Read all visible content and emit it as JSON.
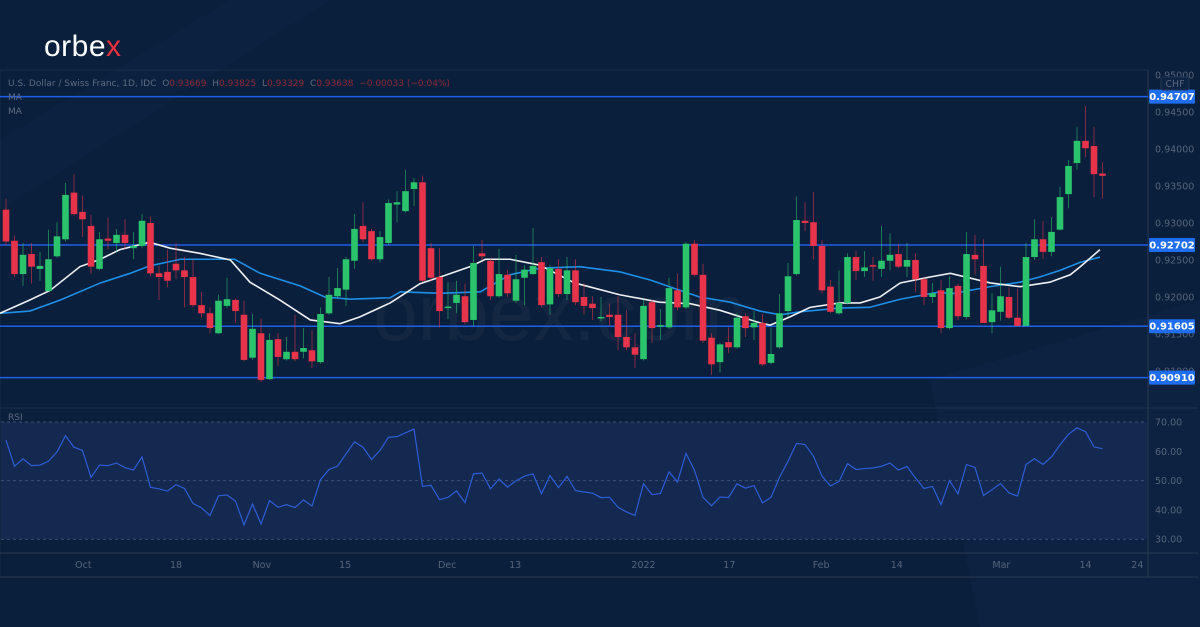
{
  "brand": {
    "logo_main": "orbe",
    "logo_x": "x",
    "watermark": "orbex.com"
  },
  "legend": {
    "symbol": "U.S. Dollar / Swiss Franc, 1D, IDC",
    "o_label": "O",
    "o": "0.93669",
    "h_label": "H",
    "h": "0.93825",
    "l_label": "L",
    "l": "0.93329",
    "c_label": "C",
    "c": "0.93638",
    "change": "−0.00033 (−0.04%)",
    "ma1": "MA",
    "ma2": "MA",
    "rsi": "RSI"
  },
  "colors": {
    "up": "#2bc46d",
    "down": "#e8344a",
    "level": "#1f5fe8",
    "level_box": "#1f6ef2",
    "ma_fast": "#eef0f2",
    "ma_slow": "#1e8fe8",
    "rsi": "#2d5ed8",
    "rsi_band": "#15284f"
  },
  "chart_data": {
    "type": "candlestick",
    "title": "U.S. Dollar / Swiss Franc, 1D, IDC",
    "currency_label": "CHF",
    "ylim": [
      0.9075,
      0.9505
    ],
    "yticks": [
      "0.95000",
      "0.94500",
      "0.94000",
      "0.93500",
      "0.93000",
      "0.92500",
      "0.92000",
      "0.91500",
      "0.91000"
    ],
    "levels": [
      "0.94707",
      "0.92702",
      "0.91605",
      "0.90910"
    ],
    "xticks": [
      {
        "label": "Oct",
        "i": 9.1
      },
      {
        "label": "18",
        "i": 20
      },
      {
        "label": "Nov",
        "i": 30.1
      },
      {
        "label": "15",
        "i": 39.9
      },
      {
        "label": "Dec",
        "i": 51.9
      },
      {
        "label": "13",
        "i": 59.9
      },
      {
        "label": "2022",
        "i": 75
      },
      {
        "label": "17",
        "i": 85.1
      },
      {
        "label": "Feb",
        "i": 95.9
      },
      {
        "label": "14",
        "i": 104.8
      },
      {
        "label": "Mar",
        "i": 117.1
      },
      {
        "label": "14",
        "i": 127
      },
      {
        "label": "24",
        "i": 133.1
      }
    ],
    "ohlc_fields": [
      "open",
      "high",
      "low",
      "close"
    ],
    "candles": [
      [
        0.9318,
        0.9333,
        0.927,
        0.9275
      ],
      [
        0.9276,
        0.9283,
        0.9227,
        0.9231
      ],
      [
        0.9231,
        0.9273,
        0.9215,
        0.9257
      ],
      [
        0.9258,
        0.9273,
        0.9218,
        0.9241
      ],
      [
        0.9238,
        0.9261,
        0.9222,
        0.9242
      ],
      [
        0.9208,
        0.9291,
        0.9208,
        0.9251
      ],
      [
        0.9255,
        0.9301,
        0.9253,
        0.9282
      ],
      [
        0.9278,
        0.9354,
        0.9275,
        0.9338
      ],
      [
        0.9341,
        0.9366,
        0.931,
        0.9312
      ],
      [
        0.9315,
        0.9337,
        0.9281,
        0.9305
      ],
      [
        0.9296,
        0.9311,
        0.9231,
        0.9241
      ],
      [
        0.9238,
        0.9288,
        0.9236,
        0.9278
      ],
      [
        0.9279,
        0.9307,
        0.9264,
        0.9276
      ],
      [
        0.9273,
        0.9292,
        0.9261,
        0.9284
      ],
      [
        0.9284,
        0.9305,
        0.9265,
        0.9273
      ],
      [
        0.9266,
        0.9288,
        0.9251,
        0.9269
      ],
      [
        0.9269,
        0.9312,
        0.9266,
        0.9303
      ],
      [
        0.93,
        0.9309,
        0.9228,
        0.9232
      ],
      [
        0.9232,
        0.9242,
        0.9196,
        0.9227
      ],
      [
        0.9234,
        0.9264,
        0.9213,
        0.9222
      ],
      [
        0.9245,
        0.9273,
        0.9224,
        0.9236
      ],
      [
        0.9236,
        0.9254,
        0.9186,
        0.9227
      ],
      [
        0.9227,
        0.9251,
        0.9186,
        0.9189
      ],
      [
        0.9189,
        0.9207,
        0.9172,
        0.9178
      ],
      [
        0.9178,
        0.9186,
        0.9151,
        0.9158
      ],
      [
        0.9151,
        0.9203,
        0.915,
        0.9195
      ],
      [
        0.9188,
        0.9226,
        0.9185,
        0.9197
      ],
      [
        0.9196,
        0.9198,
        0.9165,
        0.9181
      ],
      [
        0.9176,
        0.9195,
        0.9113,
        0.9115
      ],
      [
        0.9118,
        0.9177,
        0.9115,
        0.9157
      ],
      [
        0.9151,
        0.9171,
        0.9085,
        0.9088
      ],
      [
        0.9089,
        0.9151,
        0.9088,
        0.9142
      ],
      [
        0.9143,
        0.9151,
        0.9107,
        0.9119
      ],
      [
        0.9116,
        0.9146,
        0.9114,
        0.9126
      ],
      [
        0.9126,
        0.9176,
        0.9113,
        0.9116
      ],
      [
        0.9126,
        0.9158,
        0.9117,
        0.9131
      ],
      [
        0.9128,
        0.9155,
        0.9104,
        0.9113
      ],
      [
        0.9112,
        0.9186,
        0.911,
        0.9177
      ],
      [
        0.9178,
        0.9227,
        0.9176,
        0.9203
      ],
      [
        0.9201,
        0.9239,
        0.9199,
        0.9212
      ],
      [
        0.921,
        0.9254,
        0.9188,
        0.9251
      ],
      [
        0.9249,
        0.9312,
        0.9238,
        0.9292
      ],
      [
        0.9296,
        0.9328,
        0.9274,
        0.9278
      ],
      [
        0.9289,
        0.9292,
        0.9249,
        0.9251
      ],
      [
        0.9251,
        0.9289,
        0.9247,
        0.9281
      ],
      [
        0.9273,
        0.9332,
        0.927,
        0.9327
      ],
      [
        0.9325,
        0.9343,
        0.9301,
        0.9328
      ],
      [
        0.9316,
        0.9372,
        0.9314,
        0.9343
      ],
      [
        0.9346,
        0.9361,
        0.9323,
        0.9355
      ],
      [
        0.9355,
        0.9364,
        0.922,
        0.9222
      ],
      [
        0.9266,
        0.9273,
        0.9222,
        0.9226
      ],
      [
        0.9227,
        0.9266,
        0.9159,
        0.9181
      ],
      [
        0.9185,
        0.922,
        0.917,
        0.9187
      ],
      [
        0.9192,
        0.9222,
        0.9178,
        0.9203
      ],
      [
        0.9201,
        0.9218,
        0.9163,
        0.9166
      ],
      [
        0.9169,
        0.9269,
        0.9161,
        0.9246
      ],
      [
        0.9259,
        0.9277,
        0.925,
        0.9255
      ],
      [
        0.9249,
        0.9251,
        0.9196,
        0.9201
      ],
      [
        0.9201,
        0.9265,
        0.9199,
        0.9231
      ],
      [
        0.923,
        0.9236,
        0.92,
        0.9205
      ],
      [
        0.9195,
        0.9257,
        0.9192,
        0.9224
      ],
      [
        0.9226,
        0.9243,
        0.9189,
        0.9237
      ],
      [
        0.9231,
        0.9293,
        0.923,
        0.9242
      ],
      [
        0.9247,
        0.9254,
        0.9186,
        0.9189
      ],
      [
        0.919,
        0.9243,
        0.9176,
        0.9239
      ],
      [
        0.9238,
        0.9251,
        0.92,
        0.9204
      ],
      [
        0.9204,
        0.9254,
        0.9196,
        0.9236
      ],
      [
        0.9236,
        0.9251,
        0.9189,
        0.9193
      ],
      [
        0.92,
        0.9219,
        0.9176,
        0.9188
      ],
      [
        0.9191,
        0.9201,
        0.9169,
        0.9185
      ],
      [
        0.9171,
        0.92,
        0.9167,
        0.9173
      ],
      [
        0.9176,
        0.9191,
        0.9161,
        0.9173
      ],
      [
        0.9176,
        0.9201,
        0.9128,
        0.9146
      ],
      [
        0.9146,
        0.9182,
        0.9128,
        0.9132
      ],
      [
        0.9132,
        0.9151,
        0.9104,
        0.9122
      ],
      [
        0.9116,
        0.9196,
        0.9114,
        0.9188
      ],
      [
        0.9193,
        0.9196,
        0.9138,
        0.9158
      ],
      [
        0.9161,
        0.9184,
        0.9142,
        0.9162
      ],
      [
        0.9159,
        0.9226,
        0.9157,
        0.9212
      ],
      [
        0.9209,
        0.9232,
        0.9182,
        0.9186
      ],
      [
        0.9186,
        0.9274,
        0.9184,
        0.9272
      ],
      [
        0.9272,
        0.9277,
        0.9228,
        0.923
      ],
      [
        0.923,
        0.9245,
        0.9138,
        0.9141
      ],
      [
        0.9145,
        0.9151,
        0.9095,
        0.9109
      ],
      [
        0.9112,
        0.9138,
        0.9098,
        0.9136
      ],
      [
        0.9139,
        0.9159,
        0.9124,
        0.9132
      ],
      [
        0.9132,
        0.9178,
        0.913,
        0.9172
      ],
      [
        0.9174,
        0.9178,
        0.9146,
        0.9158
      ],
      [
        0.9159,
        0.9181,
        0.9142,
        0.9165
      ],
      [
        0.9165,
        0.9177,
        0.9107,
        0.9109
      ],
      [
        0.9111,
        0.9159,
        0.9109,
        0.9123
      ],
      [
        0.9132,
        0.9204,
        0.913,
        0.9178
      ],
      [
        0.9181,
        0.9246,
        0.9173,
        0.9228
      ],
      [
        0.9231,
        0.9336,
        0.9229,
        0.9304
      ],
      [
        0.9303,
        0.9328,
        0.9289,
        0.93
      ],
      [
        0.9301,
        0.9342,
        0.9251,
        0.9269
      ],
      [
        0.9269,
        0.9277,
        0.9205,
        0.9209
      ],
      [
        0.9214,
        0.9223,
        0.9178,
        0.918
      ],
      [
        0.9178,
        0.9236,
        0.9176,
        0.9192
      ],
      [
        0.9192,
        0.9259,
        0.919,
        0.9254
      ],
      [
        0.9254,
        0.9262,
        0.9223,
        0.9235
      ],
      [
        0.9235,
        0.9262,
        0.9227,
        0.924
      ],
      [
        0.9243,
        0.9254,
        0.9222,
        0.9241
      ],
      [
        0.9238,
        0.9296,
        0.9227,
        0.9249
      ],
      [
        0.9249,
        0.9286,
        0.9236,
        0.9257
      ],
      [
        0.9258,
        0.9272,
        0.9239,
        0.9241
      ],
      [
        0.9241,
        0.9273,
        0.9227,
        0.925
      ],
      [
        0.925,
        0.9259,
        0.9207,
        0.9224
      ],
      [
        0.9224,
        0.9226,
        0.9189,
        0.92
      ],
      [
        0.92,
        0.9219,
        0.9192,
        0.9205
      ],
      [
        0.9209,
        0.9223,
        0.9151,
        0.9158
      ],
      [
        0.9158,
        0.9228,
        0.9156,
        0.9212
      ],
      [
        0.9215,
        0.9218,
        0.9169,
        0.9174
      ],
      [
        0.9173,
        0.9288,
        0.917,
        0.9258
      ],
      [
        0.9257,
        0.9284,
        0.923,
        0.9251
      ],
      [
        0.9242,
        0.9278,
        0.9165,
        0.9165
      ],
      [
        0.9166,
        0.9205,
        0.9151,
        0.9182
      ],
      [
        0.918,
        0.9241,
        0.9168,
        0.9201
      ],
      [
        0.92,
        0.9213,
        0.917,
        0.9172
      ],
      [
        0.9172,
        0.9211,
        0.916,
        0.9161
      ],
      [
        0.9161,
        0.9273,
        0.916,
        0.9254
      ],
      [
        0.9254,
        0.9305,
        0.925,
        0.9278
      ],
      [
        0.9278,
        0.9303,
        0.9251,
        0.9261
      ],
      [
        0.9261,
        0.9308,
        0.9255,
        0.9288
      ],
      [
        0.9291,
        0.9349,
        0.929,
        0.9335
      ],
      [
        0.9339,
        0.9385,
        0.932,
        0.9377
      ],
      [
        0.9381,
        0.943,
        0.9372,
        0.9411
      ],
      [
        0.9411,
        0.9458,
        0.9389,
        0.9401
      ],
      [
        0.9404,
        0.943,
        0.9335,
        0.9366
      ],
      [
        0.93669,
        0.93825,
        0.93329,
        0.93638
      ]
    ],
    "ma_fast": [
      [
        -0.7,
        0.9178
      ],
      [
        2.8,
        0.9196
      ],
      [
        5.2,
        0.9209
      ],
      [
        8.7,
        0.9241
      ],
      [
        11.1,
        0.9251
      ],
      [
        13.4,
        0.9264
      ],
      [
        16.9,
        0.9274
      ],
      [
        19.3,
        0.9266
      ],
      [
        22.8,
        0.9259
      ],
      [
        26.4,
        0.925
      ],
      [
        28.7,
        0.922
      ],
      [
        32.2,
        0.9196
      ],
      [
        35.8,
        0.9169
      ],
      [
        39.3,
        0.9164
      ],
      [
        41.6,
        0.9173
      ],
      [
        45.2,
        0.9192
      ],
      [
        48.7,
        0.9218
      ],
      [
        51.1,
        0.9227
      ],
      [
        54.6,
        0.9241
      ],
      [
        56.4,
        0.9251
      ],
      [
        59.3,
        0.9251
      ],
      [
        62.8,
        0.9243
      ],
      [
        66.9,
        0.9219
      ],
      [
        72.2,
        0.9203
      ],
      [
        76.9,
        0.9193
      ],
      [
        80.5,
        0.9191
      ],
      [
        84,
        0.9182
      ],
      [
        88.7,
        0.9165
      ],
      [
        89.9,
        0.9162
      ],
      [
        92.2,
        0.9173
      ],
      [
        94.6,
        0.9186
      ],
      [
        98.1,
        0.9192
      ],
      [
        100.5,
        0.9192
      ],
      [
        102.8,
        0.92
      ],
      [
        105.2,
        0.9219
      ],
      [
        108.7,
        0.9227
      ],
      [
        111.1,
        0.9232
      ],
      [
        115.8,
        0.9219
      ],
      [
        119.3,
        0.9214
      ],
      [
        122.8,
        0.922
      ],
      [
        125.2,
        0.923
      ],
      [
        126.4,
        0.9241
      ],
      [
        128.7,
        0.9264
      ]
    ],
    "ma_slow": [
      [
        -0.7,
        0.9178
      ],
      [
        2.8,
        0.9181
      ],
      [
        6.4,
        0.9196
      ],
      [
        11.1,
        0.9219
      ],
      [
        14.6,
        0.9232
      ],
      [
        16.9,
        0.9242
      ],
      [
        20.5,
        0.9251
      ],
      [
        26.9,
        0.9251
      ],
      [
        29.9,
        0.9232
      ],
      [
        34.6,
        0.9215
      ],
      [
        37.5,
        0.92
      ],
      [
        40.5,
        0.9197
      ],
      [
        45.2,
        0.9199
      ],
      [
        46.4,
        0.9207
      ],
      [
        51.1,
        0.9205
      ],
      [
        55.8,
        0.9207
      ],
      [
        59.3,
        0.923
      ],
      [
        62.8,
        0.9239
      ],
      [
        67.5,
        0.9241
      ],
      [
        72.2,
        0.9234
      ],
      [
        75.8,
        0.9223
      ],
      [
        79.3,
        0.9209
      ],
      [
        81.6,
        0.92
      ],
      [
        85.2,
        0.9193
      ],
      [
        88.7,
        0.9181
      ],
      [
        91.1,
        0.9176
      ],
      [
        93.4,
        0.918
      ],
      [
        98.1,
        0.9185
      ],
      [
        101.6,
        0.9186
      ],
      [
        105.2,
        0.9197
      ],
      [
        109.9,
        0.9207
      ],
      [
        111.1,
        0.9204
      ],
      [
        115.8,
        0.9214
      ],
      [
        119.3,
        0.922
      ],
      [
        121.6,
        0.9227
      ],
      [
        124,
        0.9236
      ],
      [
        126.4,
        0.9247
      ],
      [
        128.7,
        0.9254
      ]
    ],
    "rsi": {
      "ylim": [
        30,
        70
      ],
      "yticks": [
        "70.00",
        "60.00",
        "50.00",
        "40.00",
        "30.00"
      ],
      "levels": [
        70,
        50,
        30
      ],
      "values": [
        63.8,
        54.9,
        57.4,
        55.1,
        55.3,
        56.6,
        59.8,
        65.3,
        61.4,
        60.3,
        51.1,
        55.3,
        55.1,
        56.0,
        54.4,
        53.6,
        58.1,
        47.7,
        47.2,
        46.4,
        48.6,
        47.3,
        42.2,
        40.7,
        38.1,
        44.8,
        45.1,
        43.0,
        34.9,
        42.0,
        35.2,
        43.2,
        40.9,
        41.8,
        40.8,
        43.4,
        41.3,
        50.3,
        53.8,
        54.9,
        59.1,
        63.2,
        61.4,
        57.2,
        60.3,
        64.8,
        65.0,
        66.3,
        67.6,
        48.0,
        48.4,
        43.5,
        44.3,
        46.5,
        42.5,
        52.3,
        52.6,
        47.2,
        50.5,
        47.8,
        49.9,
        51.5,
        52.3,
        45.5,
        51.7,
        47.6,
        51.4,
        46.6,
        46.1,
        45.7,
        44.2,
        44.3,
        40.9,
        39.3,
        38.1,
        48.9,
        45.2,
        45.6,
        53.0,
        49.5,
        59.3,
        53.5,
        44.3,
        41.4,
        44.4,
        44.2,
        48.9,
        47.4,
        48.3,
        42.4,
        44.3,
        51.1,
        56.6,
        62.7,
        62.3,
        58.3,
        51.5,
        48.2,
        49.7,
        55.8,
        53.8,
        54.1,
        54.3,
        54.9,
        56.0,
        53.6,
        54.8,
        50.9,
        47.3,
        48.0,
        41.8,
        50.0,
        45.5,
        55.5,
        54.5,
        44.9,
        46.9,
        49.0,
        45.8,
        44.7,
        55.5,
        57.5,
        55.5,
        58.1,
        62.2,
        65.8,
        68.0,
        66.7,
        61.5,
        60.9
      ]
    }
  }
}
